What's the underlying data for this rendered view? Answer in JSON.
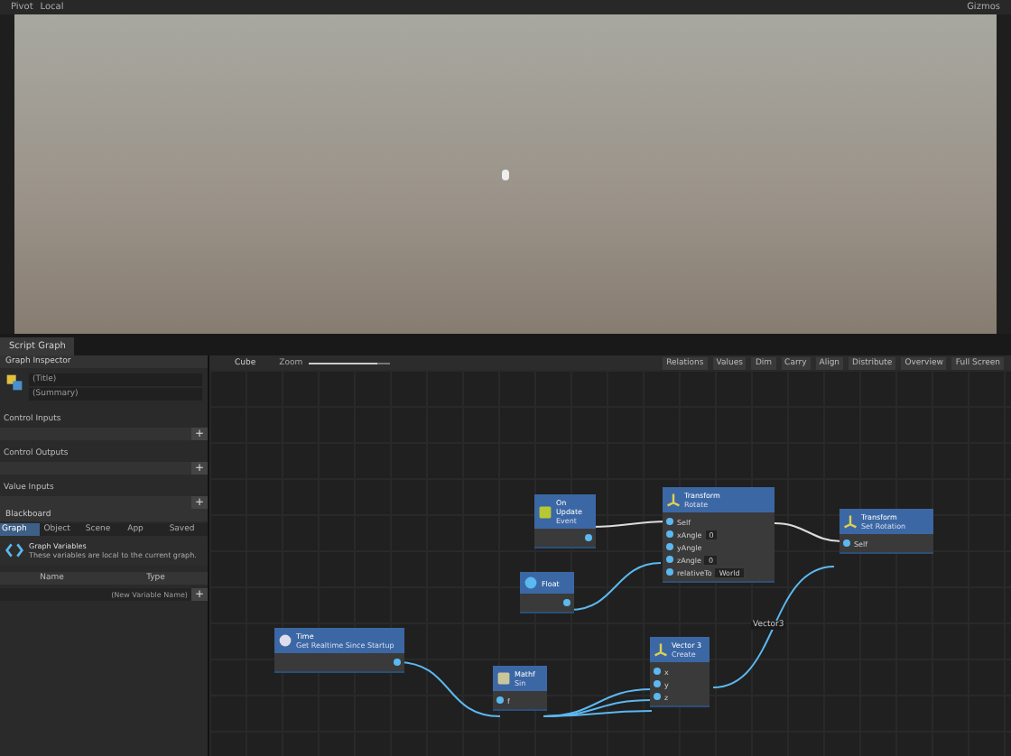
{
  "scene_toolbar": {
    "left": [
      "Pivot",
      "Local"
    ],
    "right": [
      "Gizmos"
    ]
  },
  "window_tab": "Script Graph",
  "inspector": {
    "title": "Graph Inspector",
    "graph_title": "(Title)",
    "graph_summary": "(Summary)",
    "sections": [
      {
        "label": "Control Inputs",
        "add": "+"
      },
      {
        "label": "Control Outputs",
        "add": "+"
      },
      {
        "label": "Value Inputs",
        "add": "+"
      }
    ],
    "blackboard_title": "Blackboard",
    "variable_tabs": [
      {
        "label": "Graph",
        "selected": true
      },
      {
        "label": "Object",
        "selected": false
      },
      {
        "label": "Scene",
        "selected": false
      },
      {
        "label": "App",
        "selected": false
      },
      {
        "label": "Saved",
        "selected": false
      }
    ],
    "variables_heading": "Graph Variables",
    "variables_description": "These variables are local to the current graph.",
    "columns": [
      "Name",
      "Type"
    ],
    "new_variable_placeholder": "(New Variable Name)",
    "new_variable_add": "+"
  },
  "graph_toolbar": {
    "breadcrumb": "Cube",
    "zoom_label": "Zoom",
    "zoom": {
      "level": 0.85
    },
    "buttons": [
      "Relations",
      "Values",
      "Dim",
      "Carry",
      "Align",
      "Distribute",
      "Overview",
      "Full Screen"
    ]
  },
  "nodes": [
    {
      "kind": "event",
      "title": "On Update",
      "subtitle": "Event"
    },
    {
      "kind": "transform",
      "title": "Transform",
      "subtitle": "Rotate",
      "rows": [
        {
          "label": "Self"
        },
        {
          "label": "xAngle",
          "value": "0"
        },
        {
          "label": "yAngle"
        },
        {
          "label": "zAngle",
          "value": "0"
        },
        {
          "label": "relativeTo",
          "value": "World"
        }
      ]
    },
    {
      "kind": "transform",
      "title": "Transform",
      "subtitle": "Set Rotation",
      "rows": [
        {
          "label": "Self"
        }
      ]
    },
    {
      "kind": "literal",
      "title": "Float"
    },
    {
      "kind": "clock",
      "title": "Time",
      "subtitle": "Get Realtime Since Startup"
    },
    {
      "kind": "math",
      "title": "Mathf",
      "subtitle": "Sin",
      "rows": [
        {
          "label": "f"
        }
      ]
    },
    {
      "kind": "vector",
      "title": "Vector 3",
      "subtitle": "Create",
      "rows": [
        {
          "label": "x"
        },
        {
          "label": "y"
        },
        {
          "label": "z"
        }
      ]
    }
  ],
  "edge_label": "Vector3"
}
